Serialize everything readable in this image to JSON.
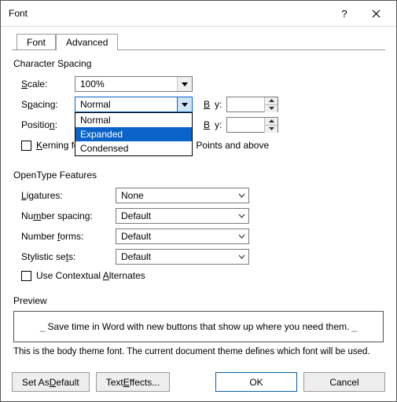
{
  "title": "Font",
  "tabs": {
    "font": "Font",
    "advanced": "Advanced"
  },
  "char_spacing": {
    "header": "Character Spacing",
    "scale_label": "Scale:",
    "scale_value": "100%",
    "spacing_label": "Spacing:",
    "spacing_value": "Normal",
    "spacing_options": [
      "Normal",
      "Expanded",
      "Condensed"
    ],
    "spacing_selected_index": 1,
    "position_label": "Position:",
    "by_label": "By:",
    "kerning_label": "Kerning for fonts:",
    "kerning_suffix": "Points and above"
  },
  "opentype": {
    "header": "OpenType Features",
    "ligatures_label": "Ligatures:",
    "ligatures_value": "None",
    "numspacing_label": "Number spacing:",
    "numspacing_value": "Default",
    "numforms_label": "Number forms:",
    "numforms_value": "Default",
    "sets_label": "Stylistic sets:",
    "sets_value": "Default",
    "contextual_label": "Use Contextual Alternates"
  },
  "preview": {
    "header": "Preview",
    "text": "Save time in Word with new buttons that show up where you need them.",
    "note": "This is the body theme font. The current document theme defines which font will be used."
  },
  "buttons": {
    "default": "Set As Default",
    "effects": "Text Effects...",
    "ok": "OK",
    "cancel": "Cancel"
  }
}
